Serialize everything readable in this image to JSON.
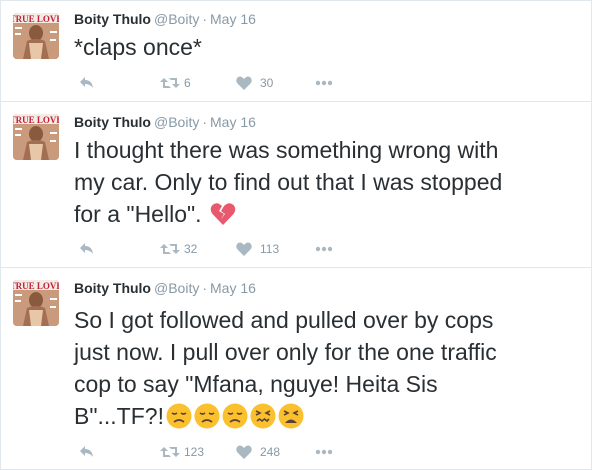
{
  "tweets": [
    {
      "author_name": "Boity Thulo",
      "handle": "@Boity",
      "separator": "·",
      "date": "May 16",
      "text_lines": [
        "*claps once*"
      ],
      "retweets": "6",
      "likes": "30"
    },
    {
      "author_name": "Boity Thulo",
      "handle": "@Boity",
      "separator": "·",
      "date": "May 16",
      "text_lines": [
        "I thought there was something wrong with",
        "my car. Only to find out that I was stopped",
        "for a \"Hello\"."
      ],
      "emojis": [
        "broken-heart"
      ],
      "retweets": "32",
      "likes": "113"
    },
    {
      "author_name": "Boity Thulo",
      "handle": "@Boity",
      "separator": "·",
      "date": "May 16",
      "text_lines": [
        "So I got followed and pulled over by cops",
        "just now. I pull over only for the one traffic",
        "cop to say \"Mfana, nguye! Heita Sis",
        "B\"...TF?!"
      ],
      "emojis": [
        "disappointed-face",
        "disappointed-face",
        "disappointed-face",
        "confounded-face",
        "tired-face"
      ],
      "retweets": "123",
      "likes": "248"
    }
  ],
  "avatar_text": "TRUE LOVE",
  "colors": {
    "text": "#292f33",
    "muted": "#8899a6",
    "icon": "#aab8c2",
    "border": "#e1e8ed",
    "broken_heart": "#e8596e",
    "emoji_yellow": "#fbc02d"
  }
}
